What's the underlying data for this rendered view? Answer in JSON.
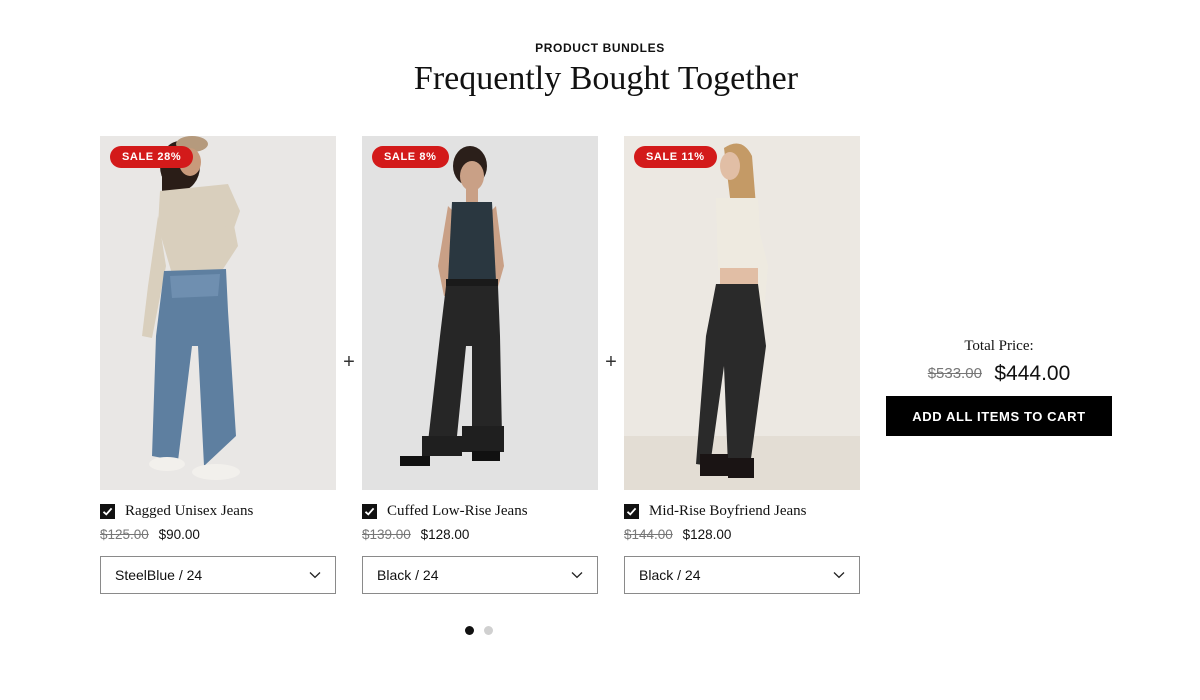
{
  "section": {
    "eyebrow": "PRODUCT BUNDLES",
    "title": "Frequently Bought Together"
  },
  "products": [
    {
      "badge": "SALE 28%",
      "name": "Ragged Unisex Jeans",
      "compare_price": "$125.00",
      "price": "$90.00",
      "variant": "SteelBlue / 24",
      "checked": true
    },
    {
      "badge": "SALE 8%",
      "name": "Cuffed Low-Rise Jeans",
      "compare_price": "$139.00",
      "price": "$128.00",
      "variant": "Black / 24",
      "checked": true
    },
    {
      "badge": "SALE 11%",
      "name": "Mid-Rise Boyfriend Jeans",
      "compare_price": "$144.00",
      "price": "$128.00",
      "variant": "Black / 24",
      "checked": true
    }
  ],
  "separator": "+",
  "total": {
    "label": "Total Price:",
    "compare_price": "$533.00",
    "price": "$444.00",
    "button_label": "ADD ALL ITEMS TO CART"
  },
  "pagination": {
    "pages": 2,
    "active": 1
  },
  "colors": {
    "sale_badge": "#d31a1a",
    "button": "#000000",
    "text": "#111111"
  },
  "icons": {
    "checkbox": "check-icon",
    "select": "chevron-down-icon"
  }
}
